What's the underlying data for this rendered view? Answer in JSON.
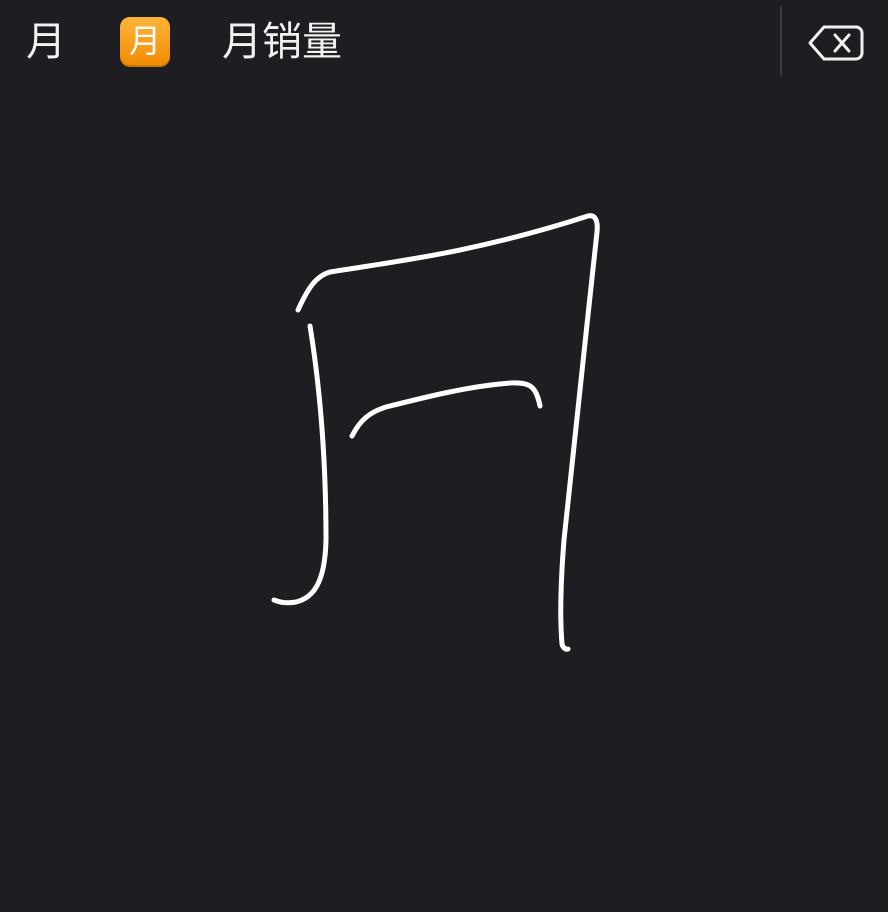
{
  "candidates": [
    {
      "label": "月"
    },
    {
      "label": "月",
      "style": "emoji",
      "badge_color": "#f59a14"
    },
    {
      "label": "月销量"
    }
  ],
  "toolbar": {
    "delete_icon": "backspace-icon"
  },
  "handwriting": {
    "stroke_color": "#ffffff",
    "background_color": "#1e1d21"
  }
}
